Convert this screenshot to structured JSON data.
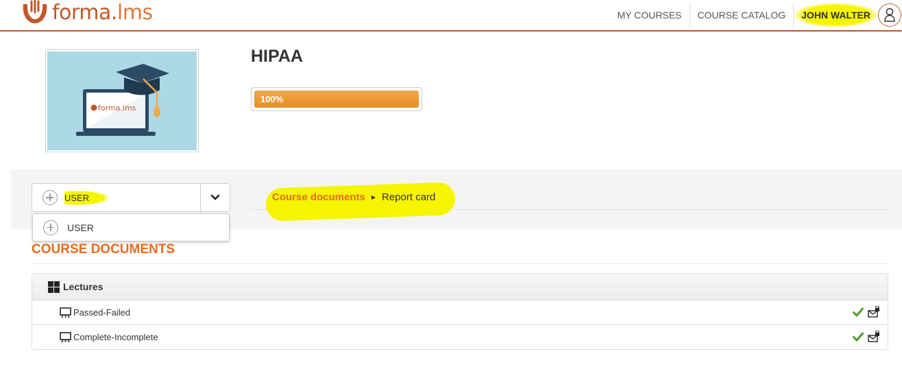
{
  "header": {
    "logo": {
      "name": "forma",
      "dot": ".",
      "suffix": "lms"
    },
    "nav": {
      "my_courses": "MY COURSES",
      "course_catalog": "COURSE CATALOG",
      "user_name": "JOHN WALTER"
    },
    "icons": {
      "user": "user-icon"
    }
  },
  "course": {
    "title": "HIPAA",
    "progress": 100,
    "progress_label": "100%",
    "thumbnail_logo_text": "forma.lms"
  },
  "role_select": {
    "selected": "USER",
    "options": [
      "USER"
    ]
  },
  "breadcrumb": {
    "link": "Course documents",
    "current": "Report card"
  },
  "section": {
    "title": "COURSE DOCUMENTS",
    "group": {
      "label": "Lectures",
      "items": [
        {
          "label": "Passed-Failed",
          "status": "check-icon",
          "action": "secure-mail-icon"
        },
        {
          "label": "Complete-Incomplete",
          "status": "check-icon",
          "action": "secure-mail-icon"
        }
      ]
    }
  },
  "colors": {
    "brand": "#c0582a",
    "accent_orange": "#e56b1f",
    "progress": "#e8952f",
    "highlight": "#f5f500",
    "check_green": "#4c9a2a",
    "thumbnail_bg": "#add8e6"
  }
}
